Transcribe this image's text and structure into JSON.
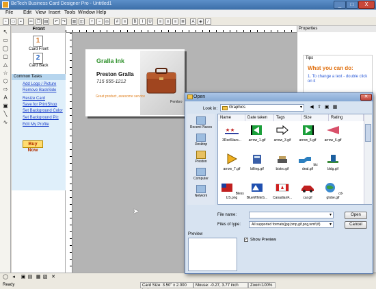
{
  "window": {
    "title": "BeTech Business Card Designer Pro - Untitled1",
    "min": "_",
    "max": "□",
    "close": "X"
  },
  "menu": [
    "File",
    "Edit",
    "View",
    "Insert",
    "Tools",
    "Window",
    "Help"
  ],
  "toolbar_icons": [
    "new-icon",
    "open-icon",
    "save-icon",
    "cut-icon",
    "copy-icon",
    "paste-icon",
    "undo-icon",
    "redo-icon",
    "print-icon",
    "preview-icon",
    "zoom-in-icon",
    "zoom-out-icon",
    "zoom-fit-icon",
    "grid-icon",
    "align-icon",
    "bold-icon",
    "italic-icon",
    "underline-icon",
    "align-left-icon",
    "align-center-icon",
    "align-right-icon",
    "justify-icon",
    "font-color-icon",
    "fill-icon",
    "line-icon"
  ],
  "front_panel": {
    "header": "Front",
    "card_front_num": "1",
    "card_front_label": "Card Front",
    "card_back_num": "2",
    "card_back_label": "Card Back"
  },
  "tasks": {
    "header": "Common Tasks",
    "items": [
      "Add Logo / Picture",
      "Remove BackSide",
      "Resize Card",
      "Save for PrintShop",
      "Set Background Color",
      "Set Background Pic",
      "Edit My Profile"
    ],
    "buy_now": "Buy Now"
  },
  "card": {
    "company": "Gralla Ink",
    "person": "Preston Gralla",
    "phone": "715 555-1212",
    "slogan": "Great product, awesome service",
    "side_text": "Pembro"
  },
  "properties": {
    "header": "Properties",
    "tips_title": "Tips",
    "what_can_do": "What you can do:",
    "tip_text": "1. To change a text - double click on it"
  },
  "status": {
    "ready": "Ready",
    "card_size": "Card Size: 3.50\" x 2.000 inches",
    "mouse": "Mouse: -0.27, 3.77 inch",
    "zoom": "Zoom:100%"
  },
  "dialog": {
    "title": "Open",
    "look_in_label": "Look in:",
    "look_in_value": "Graphics",
    "places": [
      "Recent Places",
      "Desktop",
      "Preston",
      "Computer",
      "Network"
    ],
    "columns": [
      "Name",
      "Date taken",
      "Tags",
      "Size",
      "Rating"
    ],
    "files": [
      "3RedStars...",
      "arrow_1.gif",
      "arrow_3.gif",
      "arrow_5.gif",
      "arrow_6.gif",
      "arrow_7.gif",
      "billing.gif",
      "bistro.gif",
      "biz deal.gif",
      "bldg.gif",
      "Bless US.png",
      "BlueWhiteS...",
      "CanadianF...",
      "car.gif",
      "cd-globe.gif"
    ],
    "file_name_label": "File name:",
    "file_name_value": "",
    "file_type_label": "Files of type:",
    "file_type_value": "All supported formats(jpg,bmp,gif,png,wmf,tif)",
    "open_btn": "Open",
    "cancel_btn": "Cancel",
    "preview_label": "Preview",
    "show_preview": "Show Preview"
  }
}
